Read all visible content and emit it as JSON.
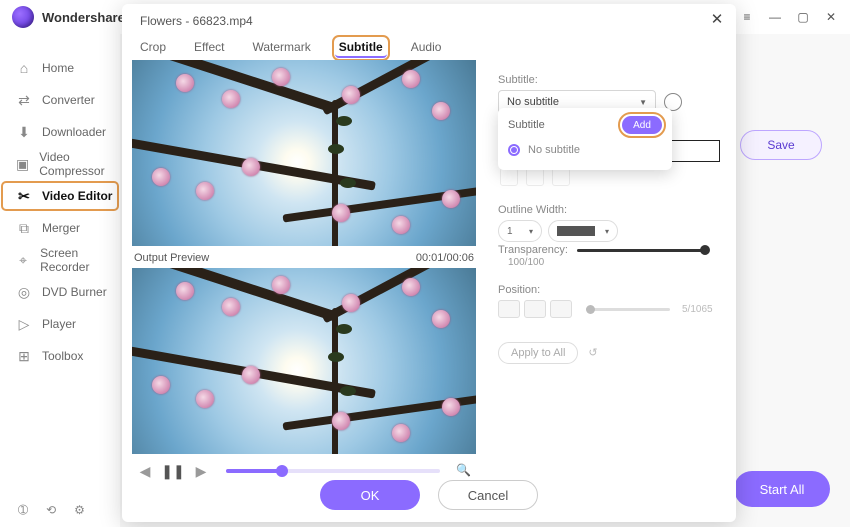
{
  "app": {
    "title": "Wondershare"
  },
  "window_ctrls": {
    "menu": "≡",
    "min": "—",
    "max": "▢",
    "close": "✕"
  },
  "sidebar": {
    "items": [
      {
        "label": "Home",
        "icon": "⌂"
      },
      {
        "label": "Converter",
        "icon": "⇄"
      },
      {
        "label": "Downloader",
        "icon": "⬇"
      },
      {
        "label": "Video Compressor",
        "icon": "▣"
      },
      {
        "label": "Video Editor",
        "icon": "✂"
      },
      {
        "label": "Merger",
        "icon": "⧉"
      },
      {
        "label": "Screen Recorder",
        "icon": "⌖"
      },
      {
        "label": "DVD Burner",
        "icon": "◎"
      },
      {
        "label": "Player",
        "icon": "▷"
      },
      {
        "label": "Toolbox",
        "icon": "⊞"
      }
    ],
    "active_index": 4,
    "bottom_icons": {
      "a": "➀",
      "b": "⟲",
      "c": "⚙"
    }
  },
  "main": {
    "save_label": "Save",
    "start_all_label": "Start All"
  },
  "modal": {
    "title": "Flowers - 66823.mp4",
    "tabs": [
      "Crop",
      "Effect",
      "Watermark",
      "Subtitle",
      "Audio"
    ],
    "active_tab_index": 3,
    "preview": {
      "output_label": "Output Preview",
      "timecode": "00:01/00:06"
    },
    "panel": {
      "subtitle_label": "Subtitle:",
      "subtitle_selected": "No subtitle",
      "dropdown": {
        "title": "Subtitle",
        "add_label": "Add",
        "option": "No subtitle"
      },
      "outline_label": "Outline Width:",
      "outline_value": "1",
      "transparency_label": "Transparency:",
      "transparency_value": "100/100",
      "position_label": "Position:",
      "position_value": "5/1065",
      "apply_label": "Apply to All"
    },
    "footer": {
      "ok": "OK",
      "cancel": "Cancel"
    }
  }
}
